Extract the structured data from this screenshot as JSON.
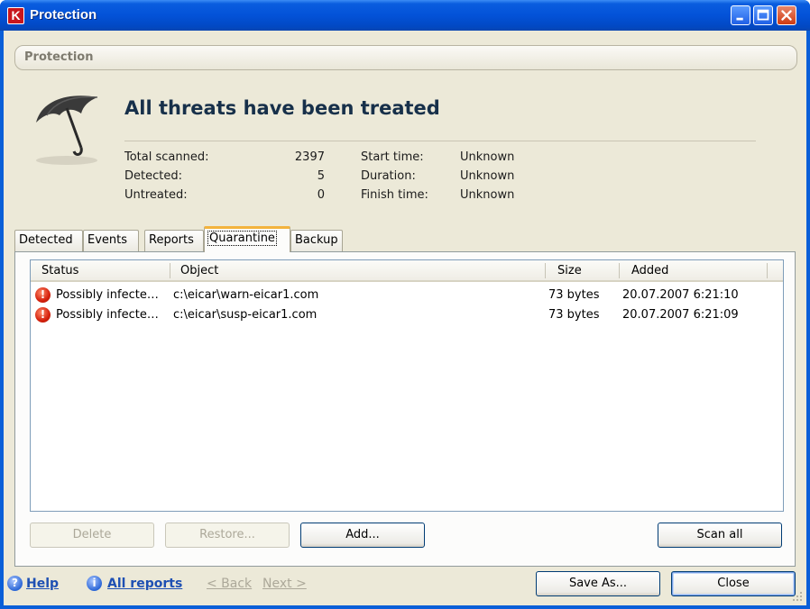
{
  "window": {
    "title": "Protection",
    "app_icon": "K"
  },
  "section": {
    "title": "Protection"
  },
  "summary": {
    "headline": "All threats have been treated",
    "total_scanned_label": "Total scanned:",
    "total_scanned_value": "2397",
    "detected_label": "Detected:",
    "detected_value": "5",
    "untreated_label": "Untreated:",
    "untreated_value": "0",
    "start_time_label": "Start time:",
    "start_time_value": "Unknown",
    "duration_label": "Duration:",
    "duration_value": "Unknown",
    "finish_time_label": "Finish time:",
    "finish_time_value": "Unknown"
  },
  "tabs": [
    {
      "label": "Detected"
    },
    {
      "label": "Events"
    },
    {
      "label": "Reports"
    },
    {
      "label": "Quarantine",
      "active": true
    },
    {
      "label": "Backup"
    }
  ],
  "list": {
    "columns": [
      "Status",
      "Object",
      "Size",
      "Added"
    ],
    "rows": [
      {
        "status": "Possibly infecte…",
        "object": "c:\\eicar\\warn-eicar1.com",
        "size": "73 bytes",
        "added": "20.07.2007 6:21:10"
      },
      {
        "status": "Possibly infecte…",
        "object": "c:\\eicar\\susp-eicar1.com",
        "size": "73 bytes",
        "added": "20.07.2007 6:21:09"
      }
    ]
  },
  "buttons": {
    "delete": "Delete",
    "restore": "Restore...",
    "add": "Add...",
    "scan_all": "Scan all",
    "save_as": "Save As...",
    "close": "Close"
  },
  "footer": {
    "help": "Help",
    "all_reports": "All reports",
    "back": "< Back",
    "next": "Next >"
  },
  "colors": {
    "titlebar": "#0352d8",
    "client_bg": "#ece9d8",
    "link": "#1e50b3",
    "warning": "#d4200c"
  }
}
